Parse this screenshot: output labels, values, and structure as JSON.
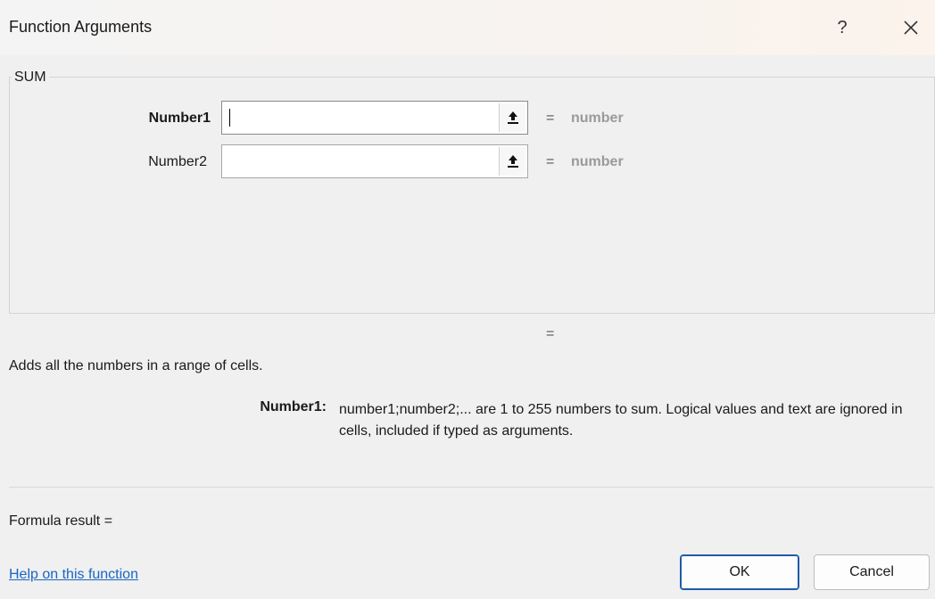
{
  "window": {
    "title": "Function Arguments",
    "help_glyph": "?",
    "close_icon": "close-icon"
  },
  "group": {
    "label": "SUM"
  },
  "arguments": [
    {
      "label": "Number1",
      "value": "",
      "equals": "=",
      "result": "number",
      "bold": true,
      "focused": true
    },
    {
      "label": "Number2",
      "value": "",
      "equals": "=",
      "result": "number",
      "bold": false,
      "focused": false
    }
  ],
  "result_equals": "=",
  "description": "Adds all the numbers in a range of cells.",
  "help": {
    "arg_name": "Number1:",
    "arg_text": "number1;number2;... are 1 to 255 numbers to sum. Logical values and text are ignored in cells, included if typed as arguments."
  },
  "formula_result": "Formula result =",
  "help_link": "Help on this function",
  "buttons": {
    "ok": "OK",
    "cancel": "Cancel"
  },
  "colors": {
    "link": "#1a66c2",
    "ok_border": "#1f5ba8",
    "hint": "#9a9a9a"
  }
}
